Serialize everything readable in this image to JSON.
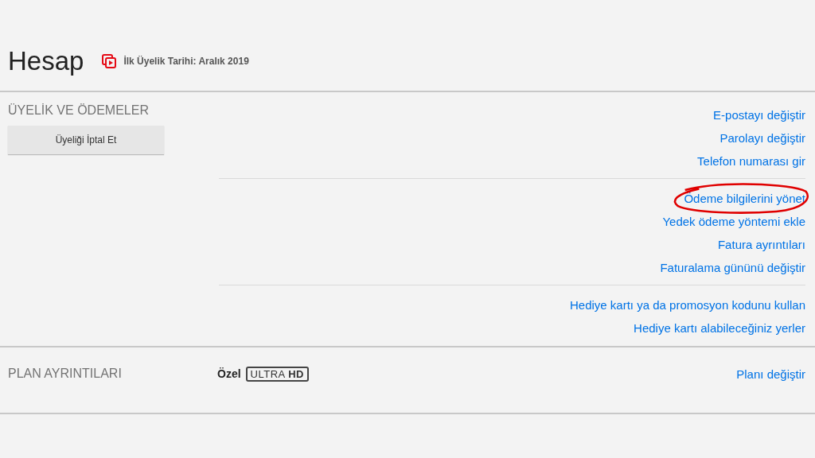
{
  "header": {
    "title": "Hesap",
    "member_since": "İlk Üyelik Tarihi: Aralık 2019"
  },
  "membership": {
    "heading": "ÜYELİK VE ÖDEMELER",
    "cancel_button": "Üyeliği İptal Et",
    "link_groups": [
      {
        "links": [
          {
            "label": "E-postayı değiştir",
            "highlighted": false
          },
          {
            "label": "Parolayı değiştir",
            "highlighted": false
          },
          {
            "label": "Telefon numarası gir",
            "highlighted": false
          }
        ]
      },
      {
        "links": [
          {
            "label": "Ödeme bilgilerini yönet",
            "highlighted": true
          },
          {
            "label": "Yedek ödeme yöntemi ekle",
            "highlighted": false
          },
          {
            "label": "Fatura ayrıntıları",
            "highlighted": false
          },
          {
            "label": "Faturalama gününü değiştir",
            "highlighted": false
          }
        ]
      },
      {
        "links": [
          {
            "label": "Hediye kartı ya da promosyon kodunu kullan",
            "highlighted": false
          },
          {
            "label": "Hediye kartı alabileceğiniz yerler",
            "highlighted": false
          }
        ]
      }
    ]
  },
  "plan": {
    "heading": "PLAN AYRINTILARI",
    "name": "Özel",
    "badge": "ULTRA **HD**",
    "link": "Planı değiştir"
  }
}
